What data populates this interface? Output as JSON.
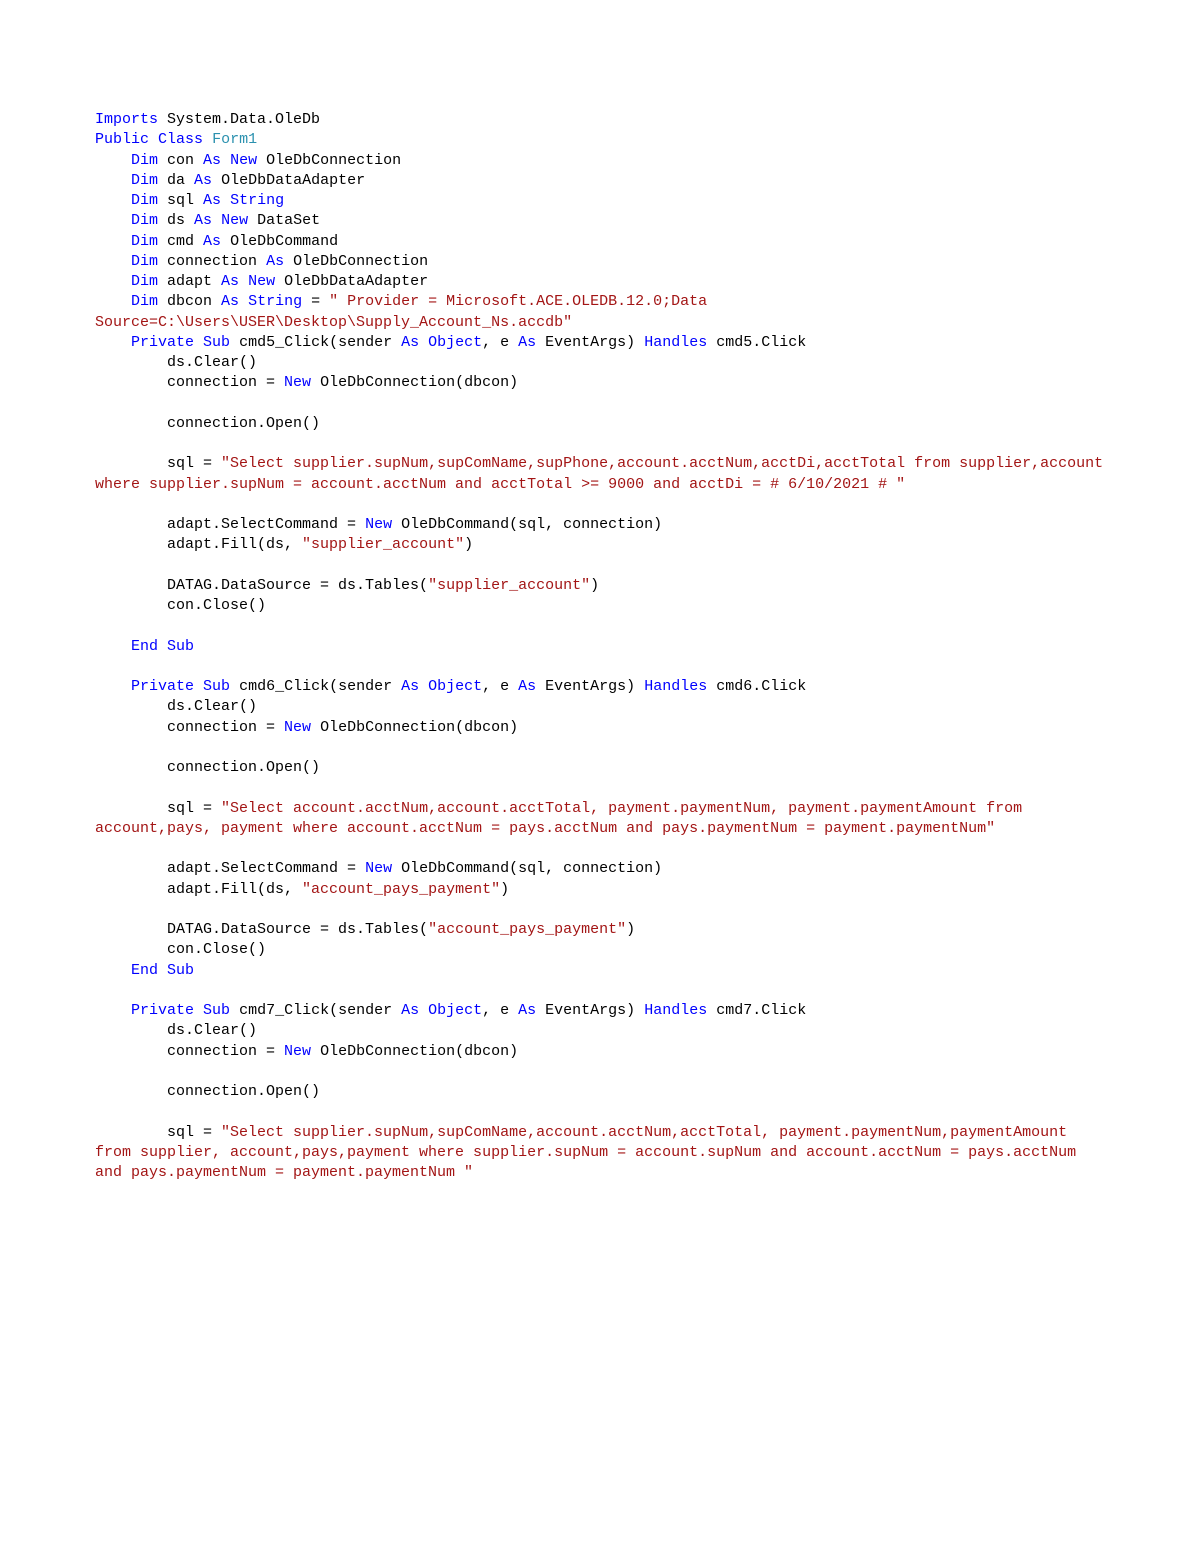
{
  "code": {
    "tokens": [
      {
        "cls": "kw",
        "t": "Imports"
      },
      {
        "cls": "pl",
        "t": " System.Data.OleDb\n"
      },
      {
        "cls": "kw",
        "t": "Public"
      },
      {
        "cls": "pl",
        "t": " "
      },
      {
        "cls": "kw",
        "t": "Class"
      },
      {
        "cls": "pl",
        "t": " "
      },
      {
        "cls": "ty",
        "t": "Form1"
      },
      {
        "cls": "pl",
        "t": "\n"
      },
      {
        "cls": "pl",
        "t": "    "
      },
      {
        "cls": "kw",
        "t": "Dim"
      },
      {
        "cls": "pl",
        "t": " con "
      },
      {
        "cls": "kw",
        "t": "As"
      },
      {
        "cls": "pl",
        "t": " "
      },
      {
        "cls": "kw",
        "t": "New"
      },
      {
        "cls": "pl",
        "t": " OleDbConnection\n"
      },
      {
        "cls": "pl",
        "t": "    "
      },
      {
        "cls": "kw",
        "t": "Dim"
      },
      {
        "cls": "pl",
        "t": " da "
      },
      {
        "cls": "kw",
        "t": "As"
      },
      {
        "cls": "pl",
        "t": " OleDbDataAdapter\n"
      },
      {
        "cls": "pl",
        "t": "    "
      },
      {
        "cls": "kw",
        "t": "Dim"
      },
      {
        "cls": "pl",
        "t": " sql "
      },
      {
        "cls": "kw",
        "t": "As"
      },
      {
        "cls": "pl",
        "t": " "
      },
      {
        "cls": "kw",
        "t": "String"
      },
      {
        "cls": "pl",
        "t": "\n"
      },
      {
        "cls": "pl",
        "t": "    "
      },
      {
        "cls": "kw",
        "t": "Dim"
      },
      {
        "cls": "pl",
        "t": " ds "
      },
      {
        "cls": "kw",
        "t": "As"
      },
      {
        "cls": "pl",
        "t": " "
      },
      {
        "cls": "kw",
        "t": "New"
      },
      {
        "cls": "pl",
        "t": " DataSet\n"
      },
      {
        "cls": "pl",
        "t": "    "
      },
      {
        "cls": "kw",
        "t": "Dim"
      },
      {
        "cls": "pl",
        "t": " cmd "
      },
      {
        "cls": "kw",
        "t": "As"
      },
      {
        "cls": "pl",
        "t": " OleDbCommand\n"
      },
      {
        "cls": "pl",
        "t": "    "
      },
      {
        "cls": "kw",
        "t": "Dim"
      },
      {
        "cls": "pl",
        "t": " connection "
      },
      {
        "cls": "kw",
        "t": "As"
      },
      {
        "cls": "pl",
        "t": " OleDbConnection\n"
      },
      {
        "cls": "pl",
        "t": "    "
      },
      {
        "cls": "kw",
        "t": "Dim"
      },
      {
        "cls": "pl",
        "t": " adapt "
      },
      {
        "cls": "kw",
        "t": "As"
      },
      {
        "cls": "pl",
        "t": " "
      },
      {
        "cls": "kw",
        "t": "New"
      },
      {
        "cls": "pl",
        "t": " OleDbDataAdapter\n"
      },
      {
        "cls": "pl",
        "t": "    "
      },
      {
        "cls": "kw",
        "t": "Dim"
      },
      {
        "cls": "pl",
        "t": " dbcon "
      },
      {
        "cls": "kw",
        "t": "As"
      },
      {
        "cls": "pl",
        "t": " "
      },
      {
        "cls": "kw",
        "t": "String"
      },
      {
        "cls": "pl",
        "t": " = "
      },
      {
        "cls": "str",
        "t": "\" Provider = Microsoft.ACE.OLEDB.12.0;Data Source=C:\\Users\\USER\\Desktop\\Supply_Account_Ns.accdb\""
      },
      {
        "cls": "pl",
        "t": "\n"
      },
      {
        "cls": "pl",
        "t": "    "
      },
      {
        "cls": "kw",
        "t": "Private"
      },
      {
        "cls": "pl",
        "t": " "
      },
      {
        "cls": "kw",
        "t": "Sub"
      },
      {
        "cls": "pl",
        "t": " cmd5_Click(sender "
      },
      {
        "cls": "kw",
        "t": "As"
      },
      {
        "cls": "pl",
        "t": " "
      },
      {
        "cls": "kw",
        "t": "Object"
      },
      {
        "cls": "pl",
        "t": ", e "
      },
      {
        "cls": "kw",
        "t": "As"
      },
      {
        "cls": "pl",
        "t": " EventArgs) "
      },
      {
        "cls": "kw",
        "t": "Handles"
      },
      {
        "cls": "pl",
        "t": " cmd5.Click\n"
      },
      {
        "cls": "pl",
        "t": "        ds.Clear()\n"
      },
      {
        "cls": "pl",
        "t": "        connection = "
      },
      {
        "cls": "kw",
        "t": "New"
      },
      {
        "cls": "pl",
        "t": " OleDbConnection(dbcon)\n"
      },
      {
        "cls": "pl",
        "t": "\n"
      },
      {
        "cls": "pl",
        "t": "        connection.Open()\n"
      },
      {
        "cls": "pl",
        "t": "\n"
      },
      {
        "cls": "pl",
        "t": "        sql = "
      },
      {
        "cls": "str",
        "t": "\"Select supplier.supNum,supComName,supPhone,account.acctNum,acctDi,acctTotal from supplier,account where supplier.supNum = account.acctNum and acctTotal >= 9000 and acctDi = # 6/10/2021 # \""
      },
      {
        "cls": "pl",
        "t": "\n"
      },
      {
        "cls": "pl",
        "t": "\n"
      },
      {
        "cls": "pl",
        "t": "        adapt.SelectCommand = "
      },
      {
        "cls": "kw",
        "t": "New"
      },
      {
        "cls": "pl",
        "t": " OleDbCommand(sql, connection)\n"
      },
      {
        "cls": "pl",
        "t": "        adapt.Fill(ds, "
      },
      {
        "cls": "str",
        "t": "\"supplier_account\""
      },
      {
        "cls": "pl",
        "t": ")\n"
      },
      {
        "cls": "pl",
        "t": "\n"
      },
      {
        "cls": "pl",
        "t": "        DATAG.DataSource = ds.Tables("
      },
      {
        "cls": "str",
        "t": "\"supplier_account\""
      },
      {
        "cls": "pl",
        "t": ")\n"
      },
      {
        "cls": "pl",
        "t": "        con.Close()\n"
      },
      {
        "cls": "pl",
        "t": "\n"
      },
      {
        "cls": "pl",
        "t": "    "
      },
      {
        "cls": "kw",
        "t": "End"
      },
      {
        "cls": "pl",
        "t": " "
      },
      {
        "cls": "kw",
        "t": "Sub"
      },
      {
        "cls": "pl",
        "t": "\n"
      },
      {
        "cls": "pl",
        "t": "\n"
      },
      {
        "cls": "pl",
        "t": "    "
      },
      {
        "cls": "kw",
        "t": "Private"
      },
      {
        "cls": "pl",
        "t": " "
      },
      {
        "cls": "kw",
        "t": "Sub"
      },
      {
        "cls": "pl",
        "t": " cmd6_Click(sender "
      },
      {
        "cls": "kw",
        "t": "As"
      },
      {
        "cls": "pl",
        "t": " "
      },
      {
        "cls": "kw",
        "t": "Object"
      },
      {
        "cls": "pl",
        "t": ", e "
      },
      {
        "cls": "kw",
        "t": "As"
      },
      {
        "cls": "pl",
        "t": " EventArgs) "
      },
      {
        "cls": "kw",
        "t": "Handles"
      },
      {
        "cls": "pl",
        "t": " cmd6.Click\n"
      },
      {
        "cls": "pl",
        "t": "        ds.Clear()\n"
      },
      {
        "cls": "pl",
        "t": "        connection = "
      },
      {
        "cls": "kw",
        "t": "New"
      },
      {
        "cls": "pl",
        "t": " OleDbConnection(dbcon)\n"
      },
      {
        "cls": "pl",
        "t": "\n"
      },
      {
        "cls": "pl",
        "t": "        connection.Open()\n"
      },
      {
        "cls": "pl",
        "t": "\n"
      },
      {
        "cls": "pl",
        "t": "        sql = "
      },
      {
        "cls": "str",
        "t": "\"Select account.acctNum,account.acctTotal, payment.paymentNum, payment.paymentAmount from account,pays, payment where account.acctNum = pays.acctNum and pays.paymentNum = payment.paymentNum\""
      },
      {
        "cls": "pl",
        "t": "\n"
      },
      {
        "cls": "pl",
        "t": "\n"
      },
      {
        "cls": "pl",
        "t": "        adapt.SelectCommand = "
      },
      {
        "cls": "kw",
        "t": "New"
      },
      {
        "cls": "pl",
        "t": " OleDbCommand(sql, connection)\n"
      },
      {
        "cls": "pl",
        "t": "        adapt.Fill(ds, "
      },
      {
        "cls": "str",
        "t": "\"account_pays_payment\""
      },
      {
        "cls": "pl",
        "t": ")\n"
      },
      {
        "cls": "pl",
        "t": "\n"
      },
      {
        "cls": "pl",
        "t": "        DATAG.DataSource = ds.Tables("
      },
      {
        "cls": "str",
        "t": "\"account_pays_payment\""
      },
      {
        "cls": "pl",
        "t": ")\n"
      },
      {
        "cls": "pl",
        "t": "        con.Close()\n"
      },
      {
        "cls": "pl",
        "t": "    "
      },
      {
        "cls": "kw",
        "t": "End"
      },
      {
        "cls": "pl",
        "t": " "
      },
      {
        "cls": "kw",
        "t": "Sub"
      },
      {
        "cls": "pl",
        "t": "\n"
      },
      {
        "cls": "pl",
        "t": "\n"
      },
      {
        "cls": "pl",
        "t": "    "
      },
      {
        "cls": "kw",
        "t": "Private"
      },
      {
        "cls": "pl",
        "t": " "
      },
      {
        "cls": "kw",
        "t": "Sub"
      },
      {
        "cls": "pl",
        "t": " cmd7_Click(sender "
      },
      {
        "cls": "kw",
        "t": "As"
      },
      {
        "cls": "pl",
        "t": " "
      },
      {
        "cls": "kw",
        "t": "Object"
      },
      {
        "cls": "pl",
        "t": ", e "
      },
      {
        "cls": "kw",
        "t": "As"
      },
      {
        "cls": "pl",
        "t": " EventArgs) "
      },
      {
        "cls": "kw",
        "t": "Handles"
      },
      {
        "cls": "pl",
        "t": " cmd7.Click\n"
      },
      {
        "cls": "pl",
        "t": "        ds.Clear()\n"
      },
      {
        "cls": "pl",
        "t": "        connection = "
      },
      {
        "cls": "kw",
        "t": "New"
      },
      {
        "cls": "pl",
        "t": " OleDbConnection(dbcon)\n"
      },
      {
        "cls": "pl",
        "t": "\n"
      },
      {
        "cls": "pl",
        "t": "        connection.Open()\n"
      },
      {
        "cls": "pl",
        "t": "\n"
      },
      {
        "cls": "pl",
        "t": "        sql = "
      },
      {
        "cls": "str",
        "t": "\"Select supplier.supNum,supComName,account.acctNum,acctTotal, payment.paymentNum,paymentAmount from supplier, account,pays,payment where supplier.supNum = account.supNum and account.acctNum = pays.acctNum and pays.paymentNum = payment.paymentNum \""
      },
      {
        "cls": "pl",
        "t": "\n"
      }
    ]
  }
}
